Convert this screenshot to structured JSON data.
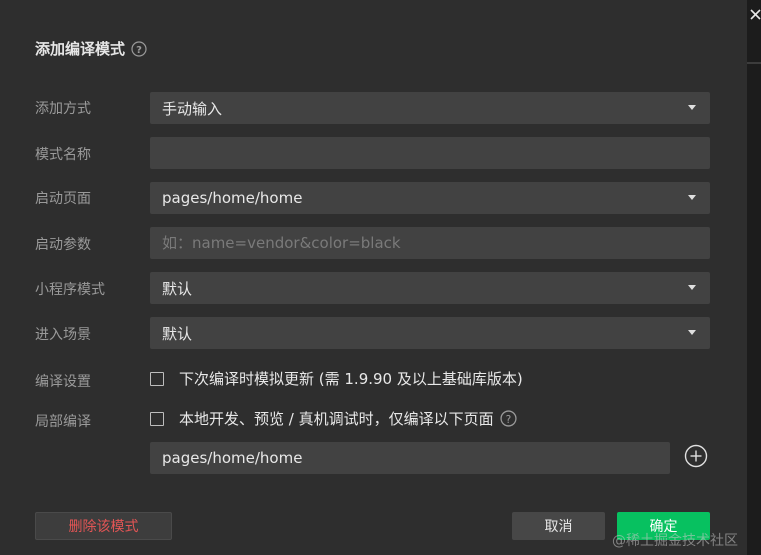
{
  "dialog": {
    "title": "添加编译模式",
    "help_icon": "question-circle-icon",
    "close_icon": "close-icon"
  },
  "form": {
    "add_method": {
      "label": "添加方式",
      "value": "手动输入"
    },
    "mode_name": {
      "label": "模式名称",
      "value": ""
    },
    "start_page": {
      "label": "启动页面",
      "value": "pages/home/home"
    },
    "start_params": {
      "label": "启动参数",
      "value": "",
      "placeholder": "如：name=vendor&color=black"
    },
    "mini_program_mode": {
      "label": "小程序模式",
      "value": "默认"
    },
    "entry_scene": {
      "label": "进入场景",
      "value": "默认"
    },
    "compile_settings": {
      "label": "编译设置",
      "checkbox_text": "下次编译时模拟更新 (需 1.9.90 及以上基础库版本)",
      "checked": false
    },
    "partial_compile": {
      "label": "局部编译",
      "checkbox_text": "本地开发、预览 / 真机调试时，仅编译以下页面",
      "checked": false,
      "page_value": "pages/home/home"
    }
  },
  "buttons": {
    "delete": "删除该模式",
    "cancel": "取消",
    "ok": "确定"
  },
  "watermark": "@稀土掘金技术社区",
  "colors": {
    "accent": "#07c160",
    "danger": "#e35555",
    "background": "#2e2e2e"
  }
}
